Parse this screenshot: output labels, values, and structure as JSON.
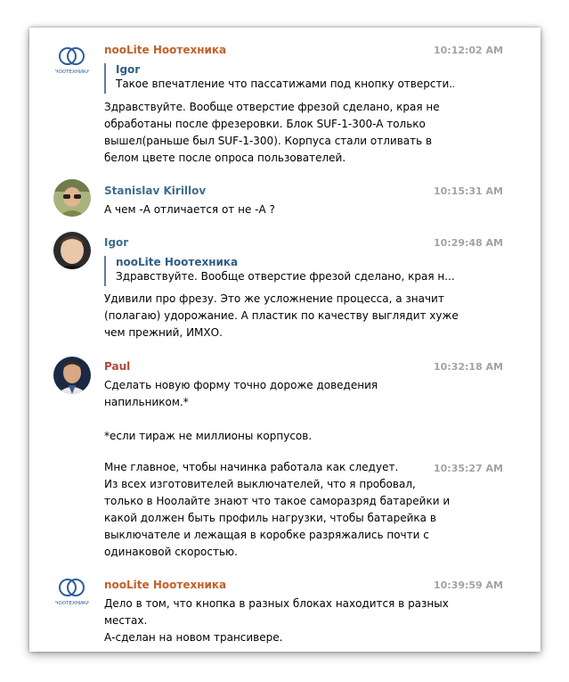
{
  "messages": [
    {
      "author": "nooLite Ноотехника",
      "author_color": "#c2612a",
      "time": "10:12:02 AM",
      "avatar": "nooLite-logo",
      "logo_caption": "НООТЕХНИКА",
      "quote": {
        "author": "Igor",
        "text": "Такое впечатление что пассатижами под кнопку отверсти..."
      },
      "text": [
        "Здравствуйте. Вообще отверстие фрезой сделано, края не",
        "обработаны после фрезеровки. Блок SUF-1-300-A только",
        "вышел(раньше был SUF-1-300). Корпуса стали отливать в",
        "белом цвете после опроса пользователей."
      ]
    },
    {
      "author": "Stanislav Kirillov",
      "author_color": "#3d6d8f",
      "time": "10:15:31 AM",
      "avatar": "user-photo",
      "text": [
        "А чем -А отличается от не -А ?"
      ]
    },
    {
      "author": "Igor",
      "author_color": "#3d6d8f",
      "time": "10:29:48 AM",
      "avatar": "user-photo",
      "quote": {
        "author": "nooLite Ноотехника",
        "text": "Здравствуйте. Вообще отверстие фрезой сделано, края н..."
      },
      "text": [
        "Удивили про фрезу. Это же усложнение процесса, а значит",
        "(полагаю) удорожание. А пластик по качеству выглядит хуже",
        "чем прежний, ИМХО."
      ]
    },
    {
      "author": "Paul",
      "author_color": "#b4483a",
      "time": "10:32:18 AM",
      "avatar": "user-photo",
      "text": [
        "Сделать новую форму точно дороже доведения",
        "напильником.*",
        "",
        "*если тираж не миллионы корпусов."
      ]
    },
    {
      "continuation": true,
      "time": "10:35:27 AM",
      "text": [
        "Мне главное, чтобы начинка работала как следует.",
        "Из всех изготовителей выключателей, что я пробовал,",
        "только в Ноолайте знают что такое саморазряд батарейки и",
        "какой должен быть профиль нагрузки, чтобы батарейка в",
        "выключателе и лежащая в коробке разряжались почти с",
        "одинаковой скоростью."
      ]
    },
    {
      "author": "nooLite Ноотехника",
      "author_color": "#c2612a",
      "time": "10:39:59 AM",
      "avatar": "nooLite-logo",
      "logo_caption": "НООТЕХНИКА",
      "text": [
        "Дело в том, что кнопка в разных блоках находится в разных",
        "местах.",
        "А-сделан на новом трансивере."
      ]
    }
  ]
}
